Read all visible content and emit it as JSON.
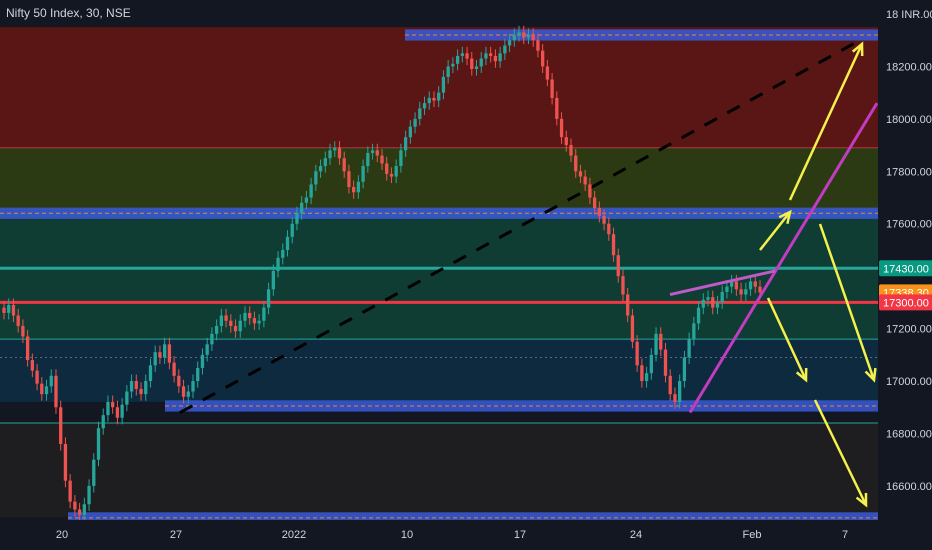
{
  "chart_data": {
    "type": "candlestick",
    "title": "Nifty 50 Index, 30, NSE",
    "currency": "INR",
    "y_axis": {
      "min": 16470,
      "max": 18400,
      "ticks": [
        18400,
        18200,
        18000,
        17800,
        17600,
        17200,
        17000,
        16800,
        16600
      ],
      "tick_labels": [
        "18 INR.00",
        "18200.00",
        "18000.00",
        "17800.00",
        "17600.00",
        "17200.00",
        "17000.00",
        "16800.00",
        "16600.00"
      ]
    },
    "x_axis": {
      "tick_labels": [
        "20",
        "27",
        "2022",
        "10",
        "17",
        "24",
        "Feb",
        "7"
      ]
    },
    "price_badges": [
      {
        "label": "17430.00",
        "value": 17430,
        "color": "#089981",
        "partial": "17400.00"
      },
      {
        "label": "17338.30",
        "value": 17338.3,
        "color": "#f7931a"
      },
      {
        "label": "17300.00",
        "value": 17300,
        "color": "#f23645"
      }
    ],
    "zones": [
      {
        "from": 18350,
        "to": 17890,
        "color": "#5a1515"
      },
      {
        "from": 17890,
        "to": 17650,
        "color": "#2c3a14"
      },
      {
        "from": 17650,
        "to": 17160,
        "color": "#0f3d33"
      },
      {
        "from": 17160,
        "to": 16920,
        "color": "#0d2a3e"
      },
      {
        "from": 16920,
        "to": 16840,
        "color": "#131722"
      },
      {
        "from": 16840,
        "to": 16480,
        "color": "#1e1e20"
      }
    ],
    "levels": [
      {
        "value": 17430,
        "color": "#26a69a"
      },
      {
        "value": 17300,
        "color": "#f23645"
      },
      {
        "value": 17160,
        "color": "#26a69a"
      },
      {
        "value": 17090,
        "color": "#5a6a7a"
      }
    ],
    "closes": [
      17260,
      17290,
      17250,
      17210,
      17170,
      17080,
      17040,
      16990,
      16950,
      16980,
      17020,
      16900,
      16760,
      16620,
      16540,
      16510,
      16490,
      16530,
      16600,
      16700,
      16820,
      16870,
      16920,
      16900,
      16860,
      16910,
      16960,
      17000,
      16970,
      16950,
      17000,
      17060,
      17110,
      17090,
      17140,
      17070,
      17020,
      16980,
      16940,
      16960,
      17000,
      17050,
      17100,
      17140,
      17180,
      17210,
      17250,
      17230,
      17210,
      17190,
      17230,
      17260,
      17240,
      17220,
      17230,
      17280,
      17350,
      17420,
      17470,
      17500,
      17550,
      17600,
      17640,
      17680,
      17700,
      17750,
      17800,
      17820,
      17850,
      17880,
      17890,
      17850,
      17800,
      17740,
      17720,
      17760,
      17820,
      17870,
      17880,
      17860,
      17830,
      17790,
      17780,
      17820,
      17880,
      17930,
      17970,
      18000,
      18040,
      18060,
      18080,
      18070,
      18100,
      18160,
      18200,
      18210,
      18240,
      18250,
      18230,
      18190,
      18200,
      18230,
      18250,
      18240,
      18220,
      18250,
      18280,
      18300,
      18320,
      18330,
      18310,
      18320,
      18300,
      18260,
      18200,
      18150,
      18080,
      18000,
      17930,
      17900,
      17860,
      17800,
      17780,
      17750,
      17700,
      17660,
      17630,
      17600,
      17560,
      17480,
      17400,
      17330,
      17250,
      17150,
      17060,
      17000,
      17030,
      17100,
      17180,
      17120,
      17020,
      16950,
      16920,
      17000,
      17090,
      17160,
      17220,
      17280,
      17310,
      17320,
      17280,
      17300,
      17340,
      17360,
      17380,
      17350,
      17330,
      17350,
      17380,
      17360,
      17338.3
    ],
    "annotation_lines": [
      {
        "color": "#c13cc1",
        "label": "rising trendline"
      },
      {
        "color": "#c05ac9",
        "label": "upper trendline"
      },
      {
        "color": "#f6f04a",
        "label": "scenario arrows"
      }
    ],
    "grid": false,
    "legend": "none"
  }
}
